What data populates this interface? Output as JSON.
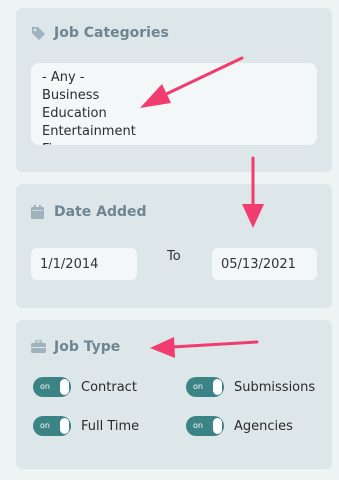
{
  "categories": {
    "title": "Job Categories",
    "icon": "tag-icon",
    "items": [
      "- Any -",
      "Business",
      "Education",
      "Entertainment",
      "Fi"
    ]
  },
  "date_added": {
    "title": "Date Added",
    "icon": "calendar-icon",
    "from_value": "1/1/2014",
    "to_label": "To",
    "to_value": "05/13/2021"
  },
  "job_type": {
    "title": "Job Type",
    "icon": "briefcase-icon",
    "options": [
      {
        "label": "Contract",
        "state": "on"
      },
      {
        "label": "Submissions",
        "state": "on"
      },
      {
        "label": "Full Time",
        "state": "on"
      },
      {
        "label": "Agencies",
        "state": "on"
      }
    ]
  },
  "colors": {
    "panel_bg": "#dde7ea",
    "title_text": "#6f8591",
    "toggle_on": "#3b8384",
    "annotation_arrow": "#f03c6e"
  }
}
